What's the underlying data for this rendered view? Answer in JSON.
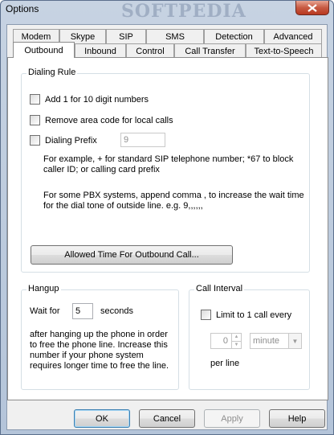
{
  "window": {
    "title": "Options",
    "watermark": "SOFTPEDIA"
  },
  "tabs_row1": [
    "Modem",
    "Skype",
    "SIP",
    "SMS",
    "Detection",
    "Advanced"
  ],
  "tabs_row2": [
    "Outbound",
    "Inbound",
    "Control",
    "Call Transfer",
    "Text-to-Speech"
  ],
  "active_tab": "Outbound",
  "dialing_rule": {
    "title": "Dialing Rule",
    "add1_label": "Add 1 for 10 digit numbers",
    "remove_area_label": "Remove area code for local calls",
    "prefix_label": "Dialing Prefix",
    "prefix_value": "9",
    "example_line1": "For example, + for standard SIP telephone number; *67 to block",
    "example_line2": "caller ID; or calling card prefix",
    "pbx_line1": "For some PBX systems, append comma , to increase the wait time",
    "pbx_line2": "for the dial tone of outside line. e.g. 9,,,,,,",
    "allowed_time_button": "Allowed Time For Outbound Call..."
  },
  "hangup": {
    "title": "Hangup",
    "wait_for": "Wait for",
    "seconds_value": "5",
    "seconds": "seconds",
    "desc_line1": "after hanging up the phone in order",
    "desc_line2": "to free the phone line. Increase this",
    "desc_line3": "number if your phone system",
    "desc_line4": "requires longer time to free the line."
  },
  "call_interval": {
    "title": "Call Interval",
    "limit_label": "Limit to 1 call every",
    "count_value": "0",
    "unit_value": "minute",
    "per_line": "per line"
  },
  "buttons": {
    "ok": "OK",
    "cancel": "Cancel",
    "apply": "Apply",
    "help": "Help"
  }
}
